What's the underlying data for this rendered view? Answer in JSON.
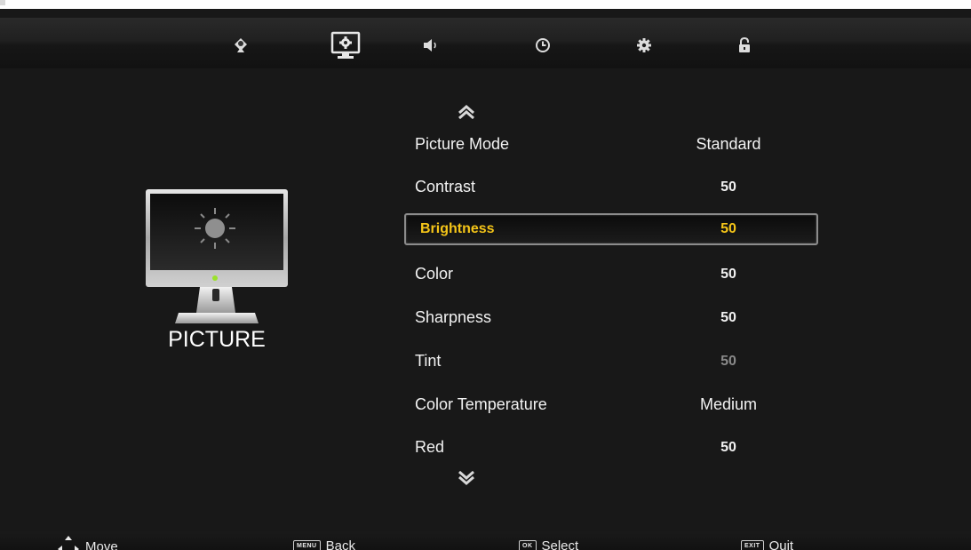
{
  "colors": {
    "background": "#181818",
    "highlight_text": "#f5c518",
    "text": "#f2f2f2",
    "disabled_text": "#8a8a8a"
  },
  "tabs": [
    {
      "name": "channel",
      "icon": "satellite-dish-icon",
      "selected": false
    },
    {
      "name": "picture",
      "icon": "monitor-gear-icon",
      "selected": true
    },
    {
      "name": "sound",
      "icon": "speaker-icon",
      "selected": false
    },
    {
      "name": "time",
      "icon": "clock-icon",
      "selected": false
    },
    {
      "name": "setup",
      "icon": "gear-icon",
      "selected": false
    },
    {
      "name": "lock",
      "icon": "padlock-icon",
      "selected": false
    }
  ],
  "section": {
    "title": "PICTURE",
    "icon": "monitor-brightness-icon"
  },
  "menu": {
    "up_icon": "double-chevron-up-icon",
    "down_icon": "double-chevron-down-icon",
    "items": [
      {
        "label": "Picture Mode",
        "value": "Standard"
      },
      {
        "label": "Contrast",
        "value": "50"
      },
      {
        "label": "Brightness",
        "value": "50",
        "selected": true
      },
      {
        "label": "Color",
        "value": "50"
      },
      {
        "label": "Sharpness",
        "value": "50"
      },
      {
        "label": "Tint",
        "value": "50",
        "disabled": true
      },
      {
        "label": "Color Temperature",
        "value": "Medium"
      },
      {
        "label": "Red",
        "value": "50"
      }
    ]
  },
  "footer": {
    "move": {
      "label": "Move",
      "icon": "arrow-keys-icon"
    },
    "back": {
      "label": "Back",
      "key": "MENU"
    },
    "select": {
      "label": "Select",
      "key": "OK"
    },
    "quit": {
      "label": "Quit",
      "key": "EXIT"
    }
  }
}
